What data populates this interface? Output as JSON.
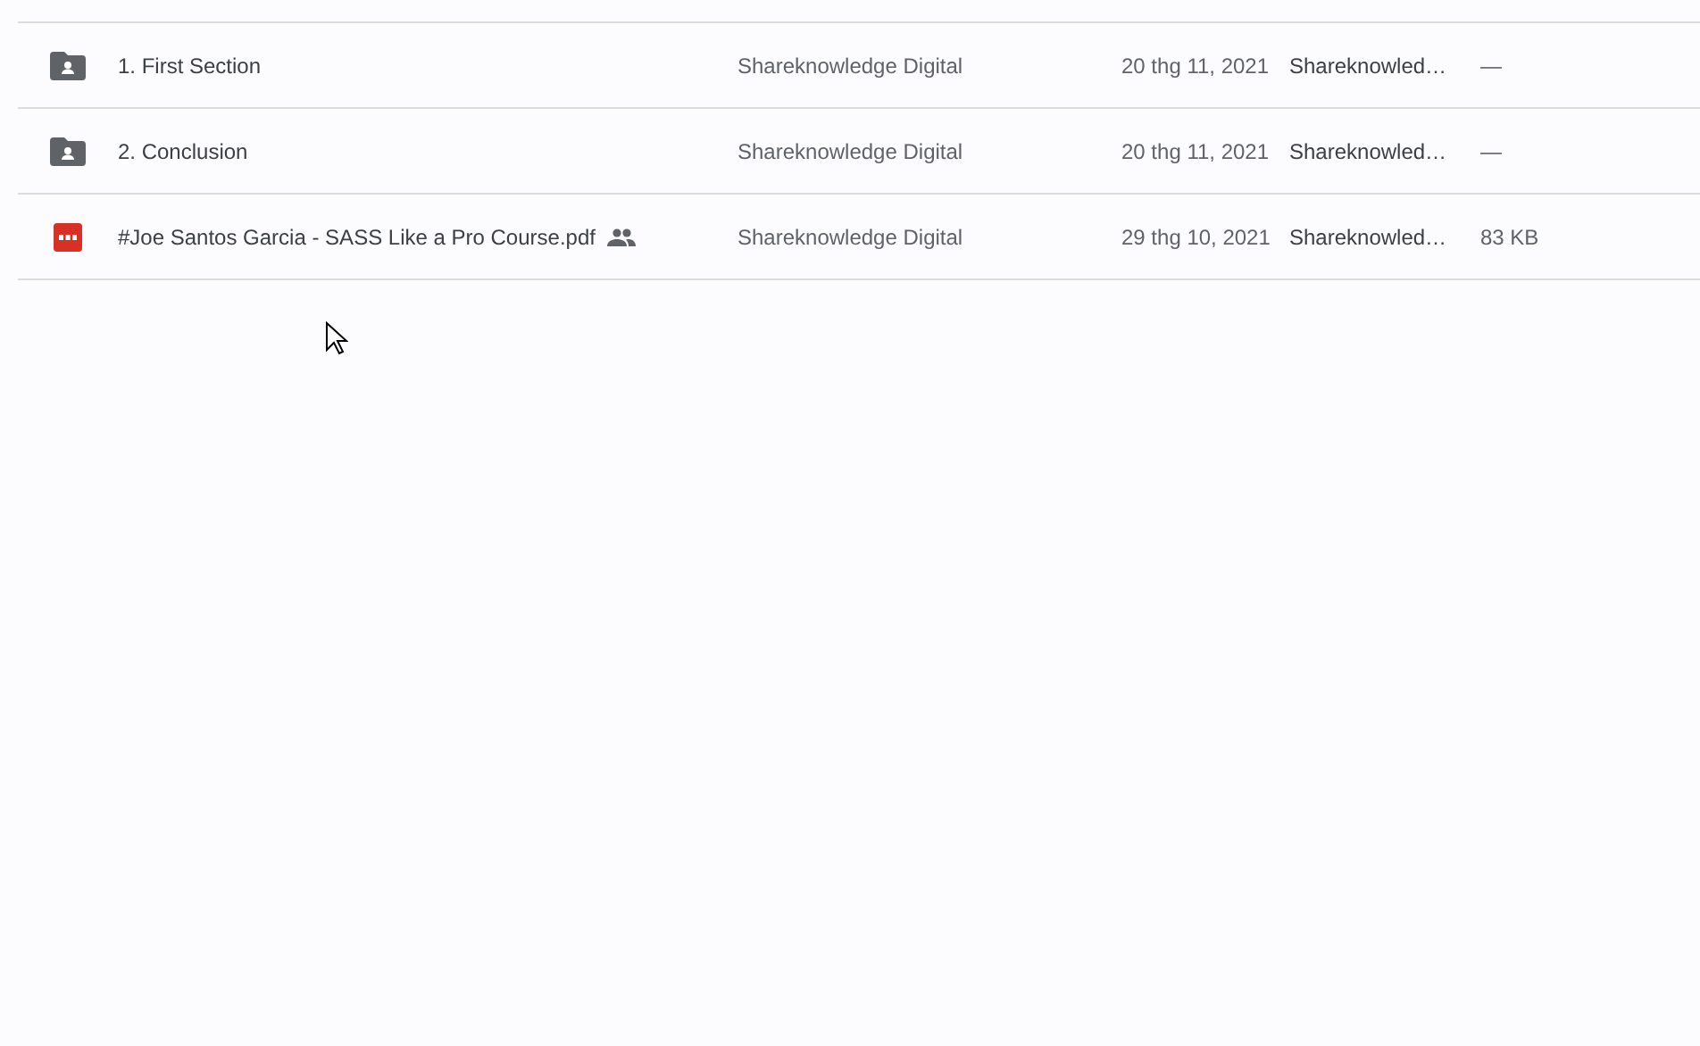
{
  "files": [
    {
      "kind": "folder",
      "name": "1. First Section",
      "shared": false,
      "owner": "Shareknowledge Digital",
      "modified": "20 thg 11, 2021",
      "modified_by": "Shareknowled…",
      "size": "—"
    },
    {
      "kind": "folder",
      "name": "2. Conclusion",
      "shared": false,
      "owner": "Shareknowledge Digital",
      "modified": "20 thg 11, 2021",
      "modified_by": "Shareknowled…",
      "size": "—"
    },
    {
      "kind": "pdf",
      "name": "#Joe Santos Garcia - SASS Like a Pro Course.pdf",
      "shared": true,
      "owner": "Shareknowledge Digital",
      "modified": "29 thg 10, 2021",
      "modified_by": "Shareknowled…",
      "size": "83 KB"
    }
  ]
}
